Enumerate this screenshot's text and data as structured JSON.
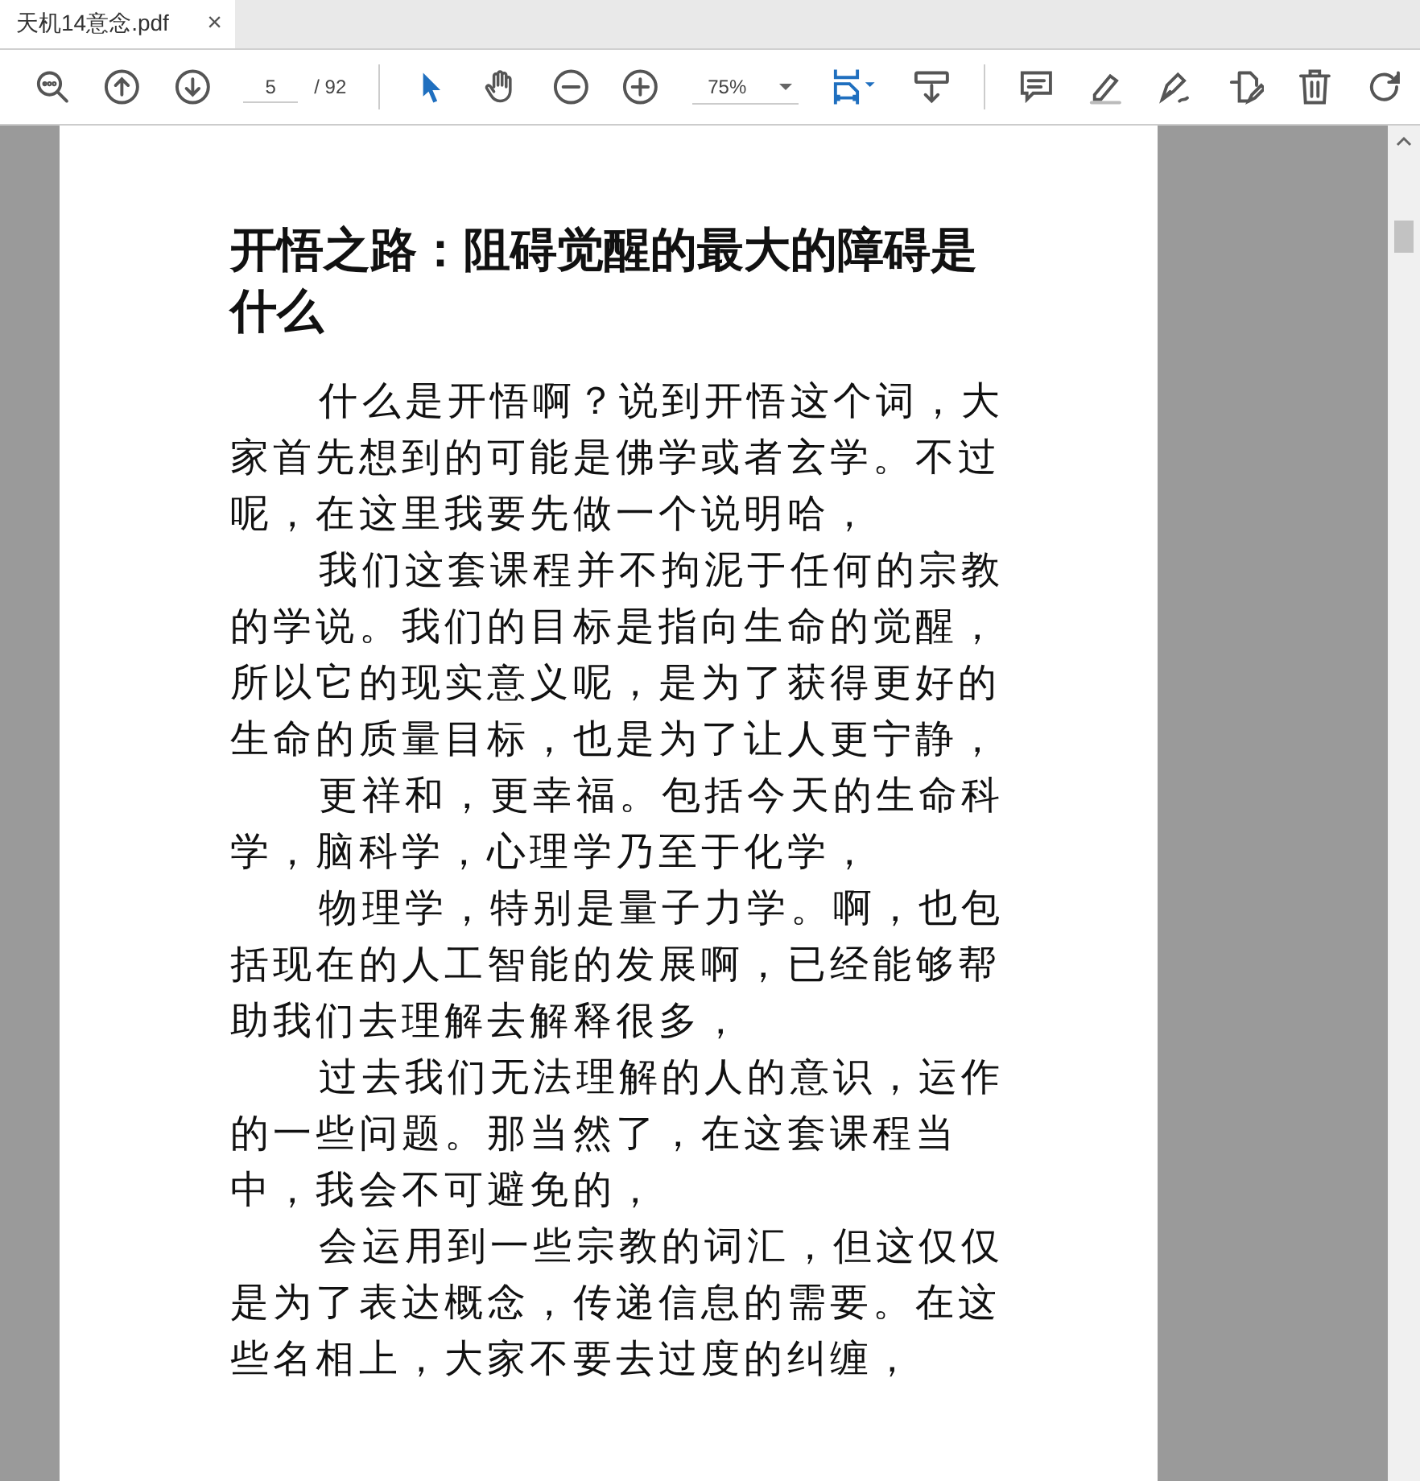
{
  "tab": {
    "title": "天机14意念.pdf",
    "close": "×"
  },
  "toolbar": {
    "page_field": "5",
    "page_total": "/ 92",
    "zoom": "75%",
    "tools": [
      {
        "kind": "select",
        "selected": true
      },
      {
        "kind": "hand",
        "selected": false
      }
    ]
  },
  "document": {
    "title": "开悟之路：阻碍觉醒的最大的障碍是什么",
    "paragraphs": [
      "什么是开悟啊？说到开悟这个词，大家首先想到的可能是佛学或者玄学。不过呢，在这里我要先做一个说明哈，",
      "我们这套课程并不拘泥于任何的宗教的学说。我们的目标是指向生命的觉醒，所以它的现实意义呢，是为了获得更好的生命的质量目标，也是为了让人更宁静，",
      "更祥和，更幸福。包括今天的生命科学，脑科学，心理学乃至于化学，",
      "物理学，特别是量子力学。啊，也包括现在的人工智能的发展啊，已经能够帮助我们去理解去解释很多，",
      "过去我们无法理解的人的意识，运作的一些问题。那当然了，在这套课程当中，我会不可避免的，",
      "会运用到一些宗教的词汇，但这仅仅是为了表达概念，传递信息的需要。在这些名相上，大家不要去过度的纠缠，"
    ]
  }
}
